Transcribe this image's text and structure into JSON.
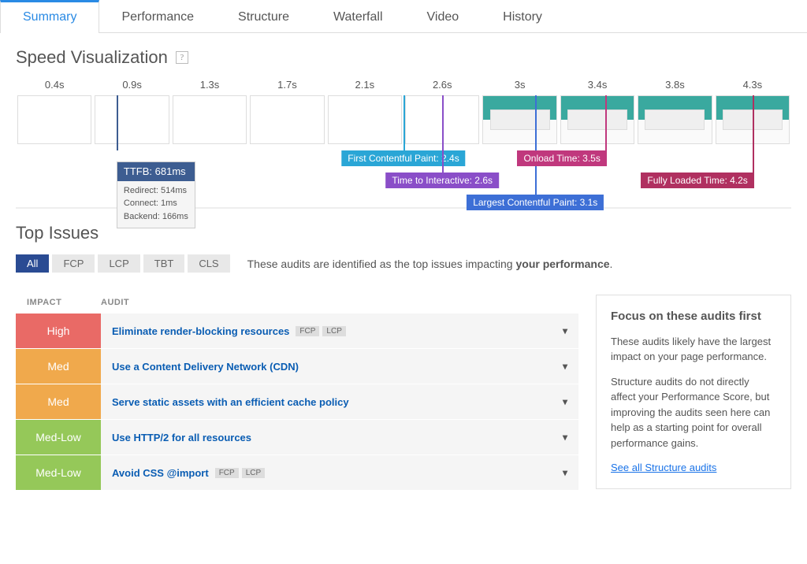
{
  "tabs": [
    "Summary",
    "Performance",
    "Structure",
    "Waterfall",
    "Video",
    "History"
  ],
  "activeTab": 0,
  "speedVis": {
    "title": "Speed Visualization",
    "times": [
      "0.4s",
      "0.9s",
      "1.3s",
      "1.7s",
      "2.1s",
      "2.6s",
      "3s",
      "3.4s",
      "3.8s",
      "4.3s"
    ],
    "loadedFromIndex": 6,
    "ttfb": {
      "label": "TTFB: 681ms",
      "lines": [
        "Redirect: 514ms",
        "Connect: 1ms",
        "Backend: 166ms"
      ],
      "colIndex": 1,
      "color": "#3d5d91"
    },
    "markers": [
      {
        "label": "First Contentful Paint: 2.4s",
        "color": "#2aa6d6",
        "row": 0,
        "colIndex": 5
      },
      {
        "label": "Time to Interactive: 2.6s",
        "color": "#8a4ec8",
        "row": 1,
        "colIndex": 5,
        "offset": 50
      },
      {
        "label": "Largest Contentful Paint: 3.1s",
        "color": "#3d6fd6",
        "row": 2,
        "colIndex": 6,
        "offset": 70
      },
      {
        "label": "Onload Time: 3.5s",
        "color": "#c0387d",
        "row": 0,
        "colIndex": 7,
        "offset": 60
      },
      {
        "label": "Fully Loaded Time: 4.2s",
        "color": "#b03060",
        "row": 1,
        "colIndex": 9,
        "offset": 50
      }
    ]
  },
  "topIssues": {
    "title": "Top Issues",
    "filters": [
      "All",
      "FCP",
      "LCP",
      "TBT",
      "CLS"
    ],
    "activeFilter": 0,
    "descPrefix": "These audits are identified as the top issues impacting ",
    "descBold": "your performance",
    "descSuffix": ".",
    "headers": {
      "impact": "IMPACT",
      "audit": "AUDIT"
    },
    "rows": [
      {
        "impact": "High",
        "impactClass": "impact-high",
        "audit": "Eliminate render-blocking resources",
        "tags": [
          "FCP",
          "LCP"
        ]
      },
      {
        "impact": "Med",
        "impactClass": "impact-med",
        "audit": "Use a Content Delivery Network (CDN)",
        "tags": []
      },
      {
        "impact": "Med",
        "impactClass": "impact-med",
        "audit": "Serve static assets with an efficient cache policy",
        "tags": []
      },
      {
        "impact": "Med-Low",
        "impactClass": "impact-medlow",
        "audit": "Use HTTP/2 for all resources",
        "tags": []
      },
      {
        "impact": "Med-Low",
        "impactClass": "impact-medlow",
        "audit": "Avoid CSS @import",
        "tags": [
          "FCP",
          "LCP"
        ]
      }
    ],
    "panel": {
      "title": "Focus on these audits first",
      "p1": "These audits likely have the largest impact on your page performance.",
      "p2": "Structure audits do not directly affect your Performance Score, but improving the audits seen here can help as a starting point for overall performance gains.",
      "link": "See all Structure audits"
    }
  }
}
